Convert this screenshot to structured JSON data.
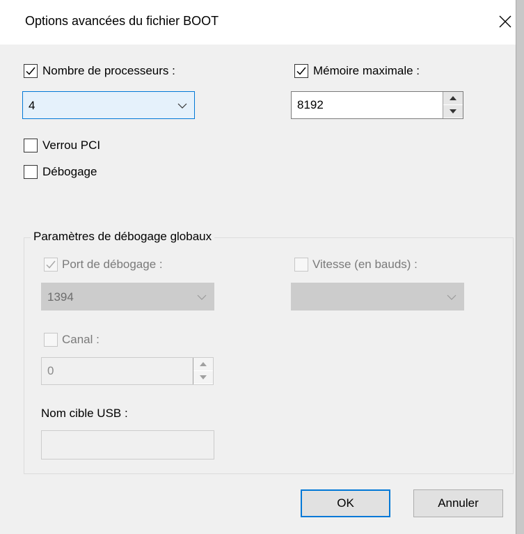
{
  "dialog": {
    "title": "Options avancées du fichier BOOT"
  },
  "processors": {
    "checkbox_label": "Nombre de processeurs :",
    "checked": true,
    "value": "4"
  },
  "memory": {
    "checkbox_label": "Mémoire maximale :",
    "checked": true,
    "value": "8192"
  },
  "pci_lock": {
    "label": "Verrou PCI",
    "checked": false
  },
  "debug": {
    "label": "Débogage",
    "checked": false
  },
  "global_debug": {
    "legend": "Paramètres de débogage globaux",
    "debug_port": {
      "label": "Port de débogage :",
      "checked": true,
      "value": "1394",
      "enabled": false
    },
    "baud_rate": {
      "label": "Vitesse (en bauds) :",
      "checked": false,
      "value": "",
      "enabled": false
    },
    "channel": {
      "label": "Canal :",
      "checked": false,
      "value": "0",
      "enabled": false
    },
    "usb_target": {
      "label": "Nom cible USB :",
      "value": "",
      "enabled": false
    }
  },
  "buttons": {
    "ok": "OK",
    "cancel": "Annuler"
  },
  "icons": {
    "close": "close-icon",
    "check": "checkmark-icon",
    "dropdown": "chevron-down-icon",
    "spin_up": "spin-up-icon",
    "spin_down": "spin-down-icon"
  },
  "colors": {
    "accent": "#0078d7",
    "dialog_bg": "#f0f0f0",
    "disabled_text": "#7a7a7a"
  }
}
